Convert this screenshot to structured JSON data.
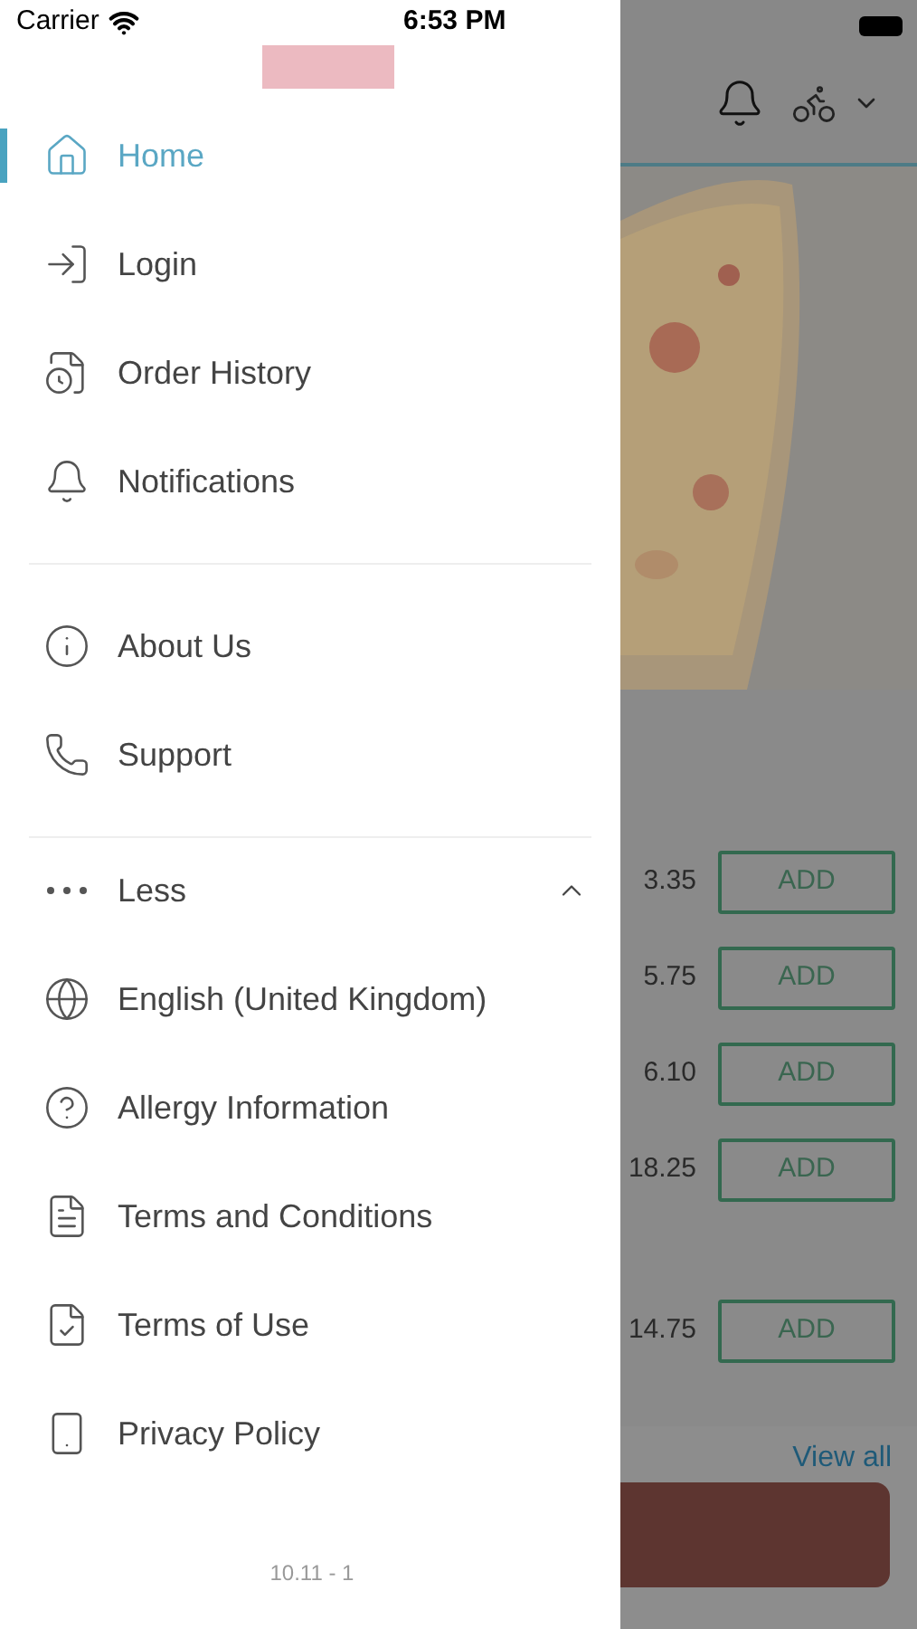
{
  "status_bar": {
    "carrier": "Carrier",
    "time": "6:53 PM"
  },
  "drawer": {
    "sections": [
      [
        {
          "label": "Home",
          "selected": true
        },
        {
          "label": "Login",
          "selected": false
        },
        {
          "label": "Order History",
          "selected": false
        },
        {
          "label": "Notifications",
          "selected": false
        }
      ],
      [
        {
          "label": "About Us",
          "selected": false
        },
        {
          "label": "Support",
          "selected": false
        }
      ]
    ],
    "toggle": {
      "label": "Less",
      "expanded": true
    },
    "more_items": [
      {
        "label": "English (United Kingdom)",
        "selected": false
      },
      {
        "label": "Allergy Information",
        "selected": false
      },
      {
        "label": "Terms and Conditions",
        "selected": false
      },
      {
        "label": "Terms of Use",
        "selected": false
      },
      {
        "label": "Privacy Policy",
        "selected": false
      }
    ],
    "version": "10.11 - 1"
  },
  "background": {
    "products": [
      {
        "price": "3.35",
        "button": "ADD"
      },
      {
        "price": "5.75",
        "button": "ADD"
      },
      {
        "price": "6.10",
        "button": "ADD"
      },
      {
        "price": "18.25",
        "button": "ADD"
      },
      {
        "price": "14.75",
        "button": "ADD"
      }
    ],
    "view_all": "View all"
  }
}
